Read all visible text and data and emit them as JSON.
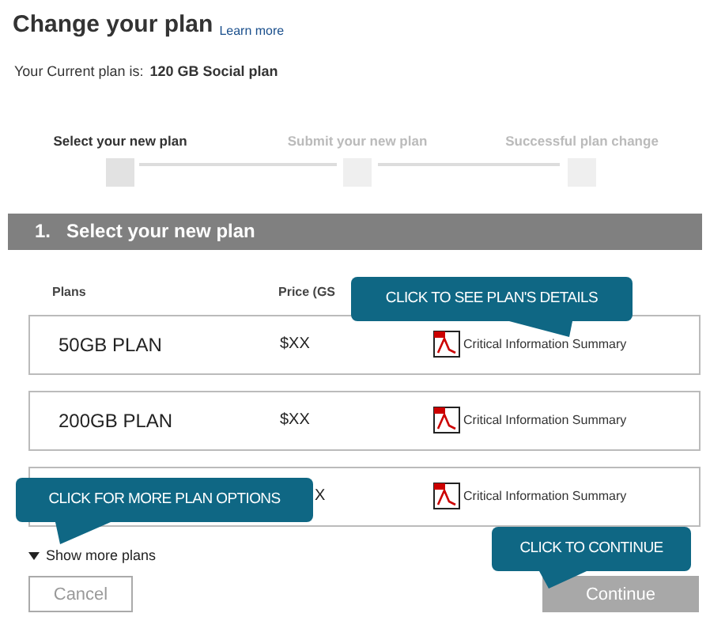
{
  "header": {
    "title": "Change your plan",
    "learn_more": "Learn more"
  },
  "current_plan": {
    "label": "Your Current plan is:",
    "value": "120 GB Social plan"
  },
  "steps": [
    {
      "label": "Select your new plan",
      "selected": true
    },
    {
      "label": "Submit your new plan",
      "selected": false
    },
    {
      "label": "Successful plan change",
      "selected": false
    }
  ],
  "section": {
    "title": "1.   Select your new plan"
  },
  "table": {
    "columns": [
      "Plans",
      "Price (GS"
    ],
    "rows": [
      {
        "plan": "50GB PLAN",
        "price": "$XX",
        "link": "Critical Information Summary"
      },
      {
        "plan": "200GB PLAN",
        "price": "$XX",
        "link": "Critical Information Summary"
      },
      {
        "price": "X",
        "link": "Critical Information Summary"
      }
    ]
  },
  "show_more": {
    "label": "Show more plans"
  },
  "buttons": [
    {
      "label": "Cancel",
      "kind": "secondary"
    },
    {
      "label": "Continue",
      "kind": "primary"
    }
  ],
  "callouts": [
    {
      "text": "CLICK TO SEE PLAN'S DETAILS",
      "kind": "down-right"
    },
    {
      "text": "CLICK FOR MORE PLAN OPTIONS",
      "kind": "down-left"
    },
    {
      "text": "CLICK TO CONTINUE",
      "kind": "down-left-short"
    }
  ]
}
